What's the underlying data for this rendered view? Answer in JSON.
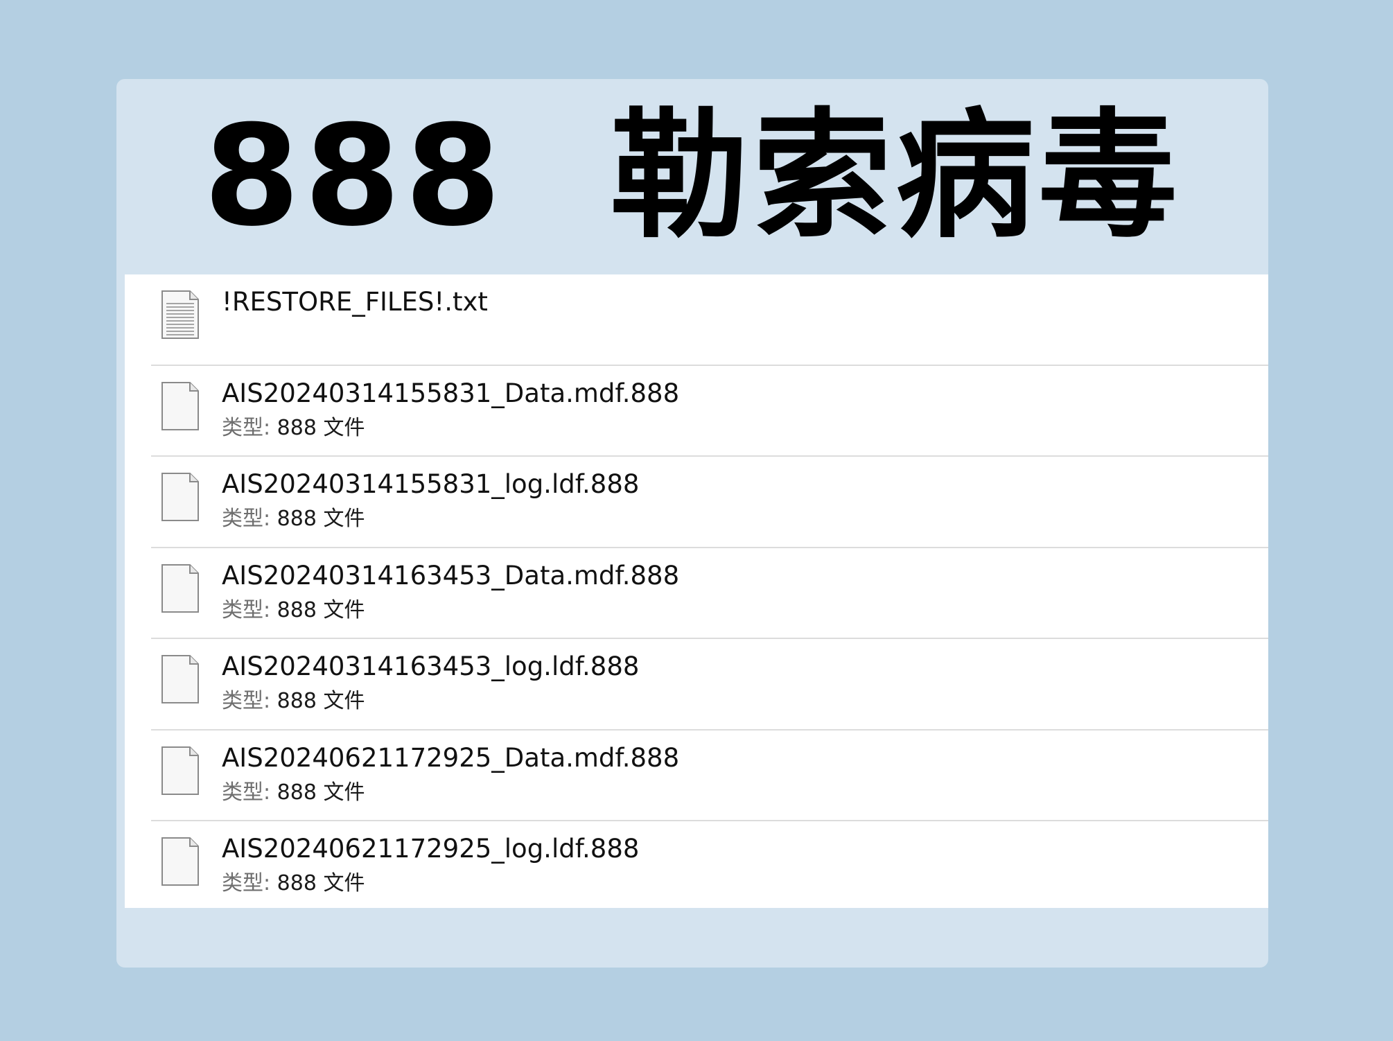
{
  "headline": "888  勒索病毒",
  "files": [
    {
      "name": "!RESTORE_FILES!.txt",
      "icon": "text-document-icon",
      "type_label": "",
      "type_value": ""
    },
    {
      "name": "AIS20240314155831_Data.mdf.888",
      "icon": "blank-file-icon",
      "type_label": "类型:",
      "type_value": " 888 文件"
    },
    {
      "name": "AIS20240314155831_log.ldf.888",
      "icon": "blank-file-icon",
      "type_label": "类型:",
      "type_value": " 888 文件"
    },
    {
      "name": "AIS20240314163453_Data.mdf.888",
      "icon": "blank-file-icon",
      "type_label": "类型:",
      "type_value": " 888 文件"
    },
    {
      "name": "AIS20240314163453_log.ldf.888",
      "icon": "blank-file-icon",
      "type_label": "类型:",
      "type_value": " 888 文件"
    },
    {
      "name": "AIS20240621172925_Data.mdf.888",
      "icon": "blank-file-icon",
      "type_label": "类型:",
      "type_value": " 888 文件"
    },
    {
      "name": "AIS20240621172925_log.ldf.888",
      "icon": "blank-file-icon",
      "type_label": "类型:",
      "type_value": " 888 文件"
    }
  ]
}
